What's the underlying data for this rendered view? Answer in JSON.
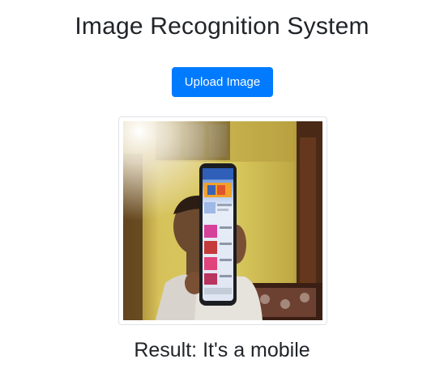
{
  "page": {
    "title": "Image Recognition System",
    "result_prefix": "Result: ",
    "result_value": "It's a mobile"
  },
  "upload": {
    "label": "Upload Image"
  },
  "preview": {
    "alt": "Uploaded photo: a person holding a mobile phone in front of their face"
  },
  "colors": {
    "accent": "#007bff",
    "text": "#212529",
    "background": "#ffffff"
  }
}
